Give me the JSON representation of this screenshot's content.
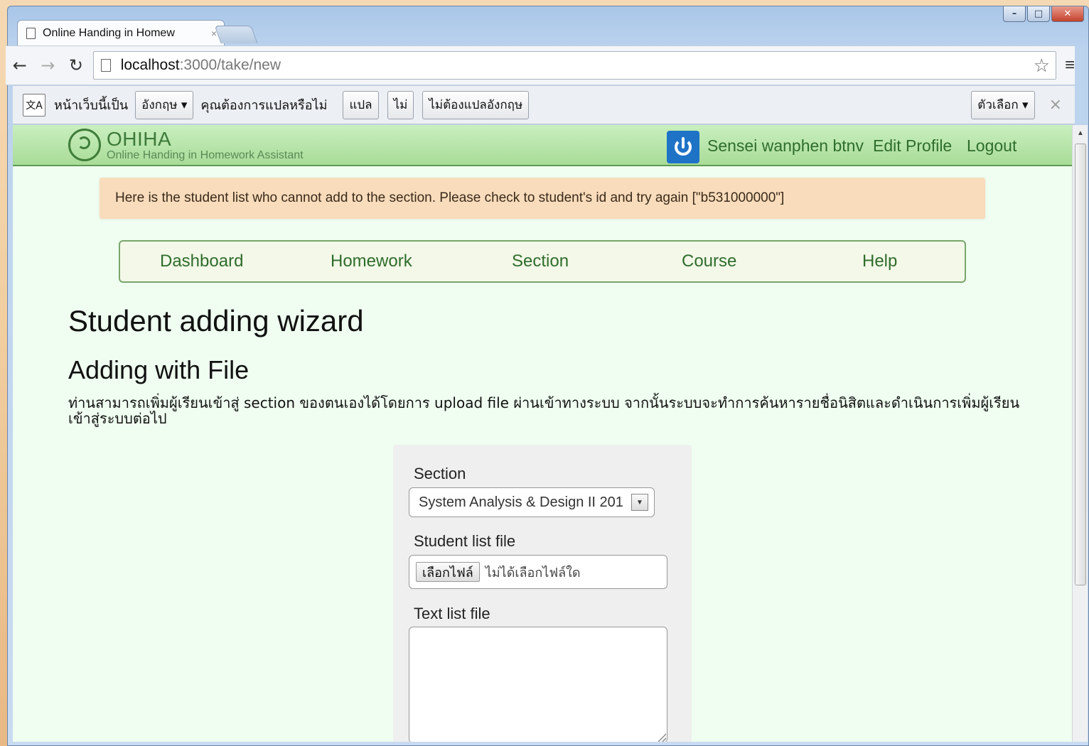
{
  "browser": {
    "tab_title": "Online Handing in Homew",
    "tab_close": "×",
    "url_host": "localhost",
    "url_rest": ":3000/take/new",
    "translate_bar": {
      "page_is_in": "หน้าเว็บนี้เป็น",
      "language": "อังกฤษ ▾",
      "question": "คุณต้องการแปลหรือไม่",
      "translate": "แปล",
      "no": "ไม่",
      "never_translate": "ไม่ต้องแปลอังกฤษ",
      "options": "ตัวเลือก ▾",
      "close": "×"
    }
  },
  "header": {
    "logo_title": "OHIHA",
    "logo_subtitle": "Online Handing in Homework Assistant",
    "user_name": "Sensei wanphen btnv",
    "edit_profile": "Edit Profile",
    "logout": "Logout"
  },
  "alert": {
    "message": "Here is the student list who cannot add to the section. Please check to student's id and try again [\"b531000000\"]"
  },
  "nav": {
    "items": [
      "Dashboard",
      "Homework",
      "Section",
      "Course",
      "Help"
    ]
  },
  "page": {
    "title": "Student adding wizard",
    "section_title": "Adding with File",
    "description": "ท่านสามารถเพิ่มผู้เรียนเข้าสู่ section ของตนเองได้โดยการ upload file ผ่านเข้าทางระบบ จากนั้นระบบจะทำการค้นหารายชื่อนิสิตและดำเนินการเพิ่มผู้เรียนเข้าสู่ระบบต่อไป"
  },
  "form": {
    "section_label": "Section",
    "section_value": "System Analysis & Design II 201",
    "student_file_label": "Student list file",
    "choose_file": "เลือกไฟล์",
    "no_file": "ไม่ได้เลือกไฟล์ใด",
    "text_file_label": "Text list file"
  }
}
